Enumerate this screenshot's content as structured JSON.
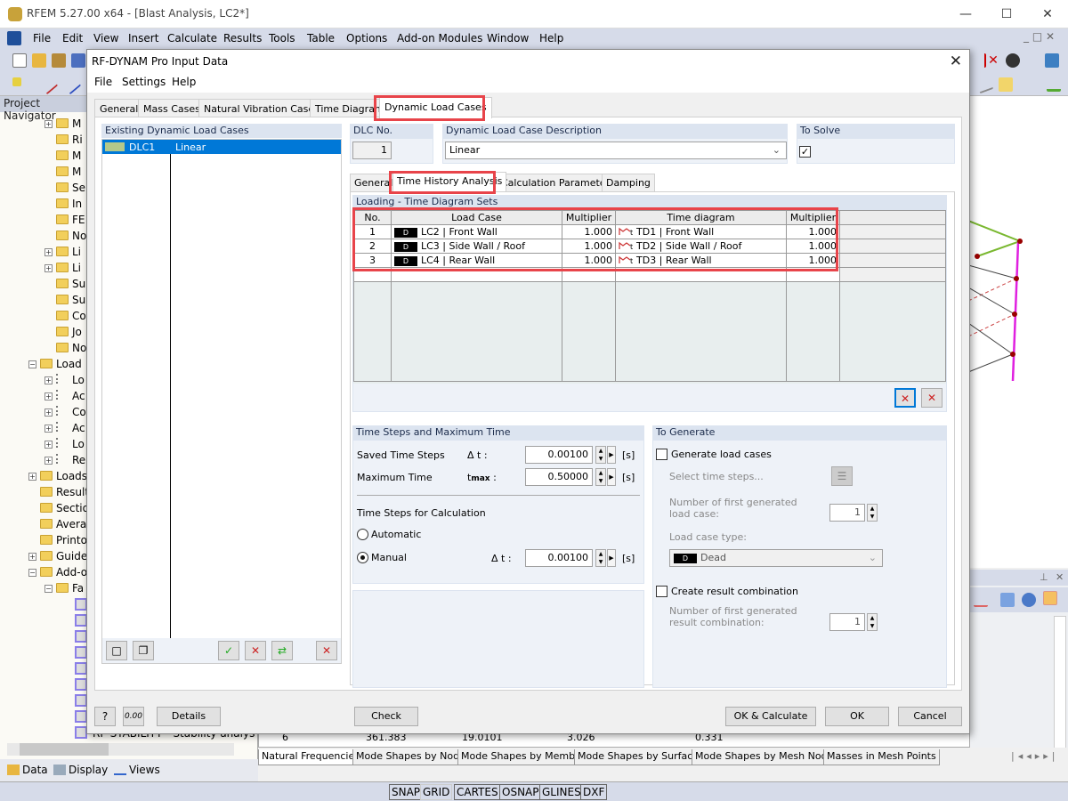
{
  "app": {
    "title": "RFEM 5.27.00 x64 - [Blast Analysis, LC2*]",
    "menu": [
      "File",
      "Edit",
      "View",
      "Insert",
      "Calculate",
      "Results",
      "Tools",
      "Table",
      "Options",
      "Add-on Modules",
      "Window",
      "Help"
    ],
    "navigator_title": "Project Navigator",
    "navigator_items": [
      {
        "label": "M",
        "expand": true
      },
      {
        "label": "Ri"
      },
      {
        "label": "M"
      },
      {
        "label": "M"
      },
      {
        "label": "Se"
      },
      {
        "label": "In"
      },
      {
        "label": "FE"
      },
      {
        "label": "No"
      },
      {
        "label": "Li",
        "expand": true
      },
      {
        "label": "Li",
        "expand": true
      },
      {
        "label": "Su"
      },
      {
        "label": "Su"
      },
      {
        "label": "Co"
      },
      {
        "label": "Jo"
      },
      {
        "label": "No"
      }
    ],
    "navigator_load_folder": "Load",
    "navigator_load_items": [
      "Lo",
      "Ac",
      "Co",
      "Ac",
      "Lo",
      "Re"
    ],
    "navigator_lower_items": [
      "Loads",
      "Result",
      "Sectio",
      "Avera",
      "Printo",
      "Guide",
      "Add-o"
    ],
    "navigator_fa": "Fa",
    "navigator_stability": "RF-STABILITY - Stability analys",
    "nav_tabs": [
      "Data",
      "Display",
      "Views"
    ],
    "result_tabs": [
      "Natural Frequencies",
      "Mode Shapes by Node",
      "Mode Shapes by Member",
      "Mode Shapes by Surface",
      "Mode Shapes by Mesh Node",
      "Masses in Mesh Points"
    ],
    "under_row": {
      "no": "6",
      "v1": "361.383",
      "v2": "19.0101",
      "v3": "3.026",
      "v4": "0.331"
    },
    "status_buttons": [
      "SNAP",
      "GRID",
      "CARTES",
      "OSNAP",
      "GLINES",
      "DXF"
    ]
  },
  "dialog": {
    "title": "RF-DYNAM Pro Input Data",
    "menu": [
      "File",
      "Settings",
      "Help"
    ],
    "tabs": [
      "General",
      "Mass Cases",
      "Natural Vibration Cases",
      "Time Diagrams",
      "Dynamic Load Cases"
    ],
    "active_tab": "Dynamic Load Cases",
    "existing_header": "Existing Dynamic Load Cases",
    "existing_cases": [
      {
        "id": "DLC1",
        "desc": "Linear",
        "color": "#b4c88a"
      }
    ],
    "dlc_no_label": "DLC No.",
    "dlc_no": "1",
    "desc_label": "Dynamic Load Case Description",
    "desc_value": "Linear",
    "to_solve_label": "To Solve",
    "to_solve_checked": true,
    "subtabs": [
      "General",
      "Time History Analysis",
      "Calculation Parameters",
      "Damping"
    ],
    "active_subtab": "Time History Analysis",
    "loading_header": "Loading - Time Diagram Sets",
    "table_headers": [
      "No.",
      "Load Case",
      "Multiplier",
      "Time diagram",
      "Multiplier"
    ],
    "table_rows": [
      {
        "no": "1",
        "badge": "D",
        "lc": "LC2 | Front Wall",
        "mult": "1.000",
        "td": "TD1 | Front Wall",
        "tdmult": "1.000"
      },
      {
        "no": "2",
        "badge": "D",
        "lc": "LC3 | Side Wall / Roof",
        "mult": "1.000",
        "td": "TD2 | Side Wall / Roof",
        "tdmult": "1.000"
      },
      {
        "no": "3",
        "badge": "D",
        "lc": "LC4 | Rear Wall",
        "mult": "1.000",
        "td": "TD3 | Rear Wall",
        "tdmult": "1.000"
      }
    ],
    "time_steps": {
      "header": "Time Steps and Maximum Time",
      "saved_label": "Saved Time Steps",
      "saved_sym": "Δ t :",
      "saved_value": "0.00100",
      "max_label": "Maximum Time",
      "max_sym": "t",
      "max_sub": "max",
      "max_value": "0.50000",
      "unit": "[s]",
      "calc_label": "Time Steps for Calculation",
      "automatic": "Automatic",
      "manual": "Manual",
      "selected": "Manual",
      "manual_sym": "Δ t :",
      "manual_value": "0.00100"
    },
    "to_generate": {
      "header": "To Generate",
      "gen_lc_label": "Generate load cases",
      "gen_lc_checked": false,
      "select_steps": "Select time steps...",
      "first_lc_label": "Number of first generated load case:",
      "first_lc_value": "1",
      "lc_type_label": "Load case type:",
      "lc_type_badge": "D",
      "lc_type_value": "Dead",
      "create_rc_label": "Create result combination",
      "create_rc_checked": false,
      "first_rc_label": "Number of first generated result combination:",
      "first_rc_value": "1"
    },
    "buttons": {
      "details": "Details",
      "check": "Check",
      "ok_calc": "OK & Calculate",
      "ok": "OK",
      "cancel": "Cancel"
    },
    "colors": {
      "highlight": "#e8444a",
      "selection": "#0078d7",
      "group_header": "#dce4f0"
    }
  }
}
